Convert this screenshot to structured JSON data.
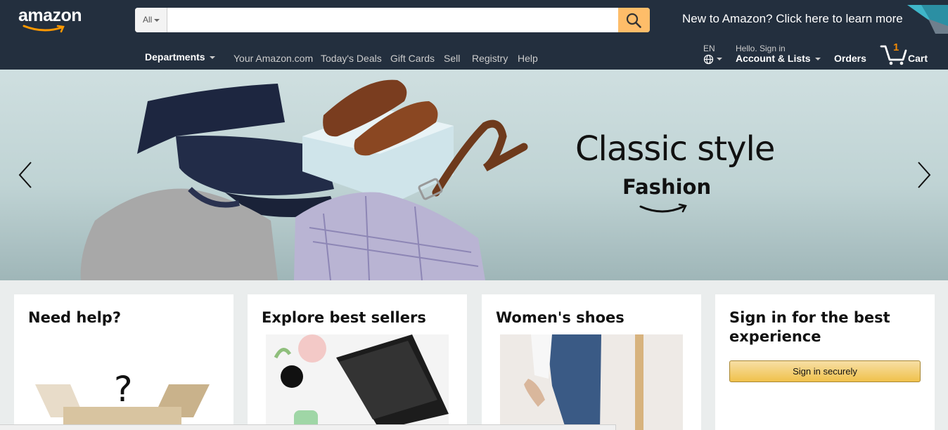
{
  "brand": {
    "logo_text": "amazon"
  },
  "search": {
    "category": "All",
    "value": "",
    "placeholder": ""
  },
  "promo": {
    "text": "New to Amazon? Click here to learn more"
  },
  "nav": {
    "departments": "Departments",
    "links": [
      "Your Amazon.com",
      "Today's Deals",
      "Gift Cards",
      "Sell",
      "Registry",
      "Help"
    ]
  },
  "language": {
    "code": "EN"
  },
  "account": {
    "hello": "Hello. Sign in",
    "main": "Account & Lists"
  },
  "orders": {
    "label": "Orders"
  },
  "cart": {
    "count": "1",
    "label": "Cart"
  },
  "hero": {
    "title": "Classic style",
    "subtitle": "Fashion"
  },
  "cards": [
    {
      "title": "Need help?"
    },
    {
      "title": "Explore best sellers"
    },
    {
      "title": "Women's shoes"
    },
    {
      "title": "Sign in for the best experience",
      "button": "Sign in securely"
    }
  ],
  "colors": {
    "nav_bg": "#232f3e",
    "search_button": "#febd69",
    "cart_count": "#f08804",
    "page_bg": "#eaeded",
    "signin_button": "#f0c14b"
  },
  "icons": [
    "search-icon",
    "globe-icon",
    "cart-icon",
    "chevron-left-icon",
    "chevron-right-icon",
    "smile-arrow-icon"
  ]
}
